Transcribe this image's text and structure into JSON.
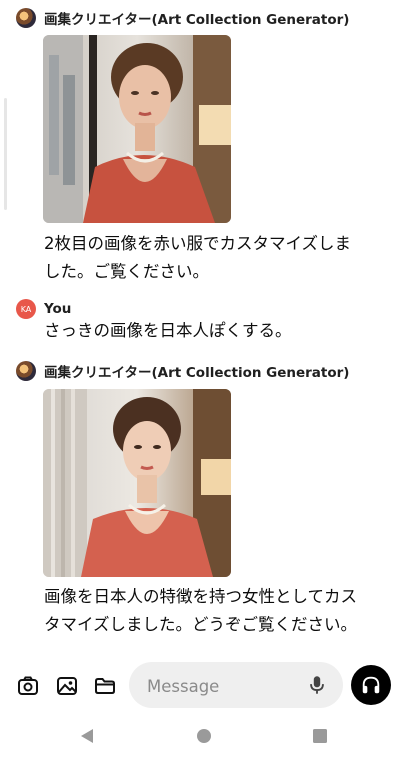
{
  "messages": [
    {
      "sender": "画集クリエイター(Art Collection Generator)",
      "text_lines": [
        "2枚目の画像を赤い服でカスタマイズしま",
        "した。ご覧ください。"
      ]
    },
    {
      "sender": "You",
      "avatar_initials": "KA",
      "text_lines": [
        "さっきの画像を日本人ぽくする。"
      ]
    },
    {
      "sender": "画集クリエイター(Art Collection Generator)",
      "text_lines": [
        "画像を日本人の特徴を持つ女性としてカス",
        "タマイズしました。どうぞご覧ください。"
      ]
    }
  ],
  "composer": {
    "placeholder": "Message",
    "icons": [
      "camera-icon",
      "image-icon",
      "folder-icon",
      "microphone-icon",
      "headphones-icon"
    ]
  },
  "nav": {
    "icons": [
      "back-icon",
      "home-icon",
      "recents-icon"
    ]
  },
  "colors": {
    "user_avatar": "#e8574a",
    "composer_bg": "#efefef",
    "voice_button": "#000000"
  }
}
